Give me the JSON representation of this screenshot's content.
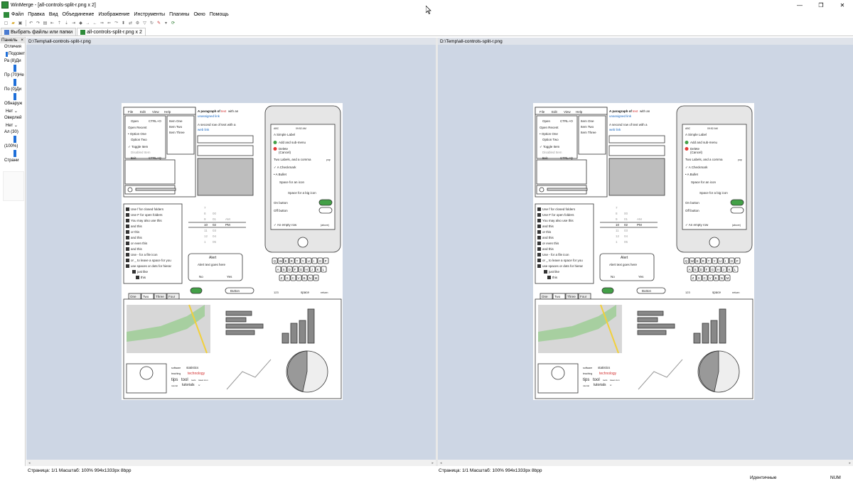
{
  "window": {
    "title": "WinMerge - [all-controls-split-r.png x 2]"
  },
  "menu": [
    "Файл",
    "Правка",
    "Вид",
    "Объединение",
    "Изображение",
    "Инструменты",
    "Плагины",
    "Окно",
    "Помощь"
  ],
  "tabs": [
    {
      "label": "Выбрать файлы или папки"
    },
    {
      "label": "all-controls-split-r.png x 2"
    }
  ],
  "panel": {
    "title": "Панель",
    "close": "×",
    "rows": [
      {
        "label": "Отличия",
        "indent": false,
        "check": false,
        "slider": false
      },
      {
        "label": "Подсвет",
        "indent": true,
        "check": true,
        "slider": false
      },
      {
        "label": "Ра (8)Ди",
        "indent": false,
        "check": false,
        "slider": false
      },
      {
        "label": "",
        "indent": false,
        "check": false,
        "slider": true
      },
      {
        "label": "Пр (70)Не",
        "indent": false,
        "check": false,
        "slider": false
      },
      {
        "label": "",
        "indent": false,
        "check": false,
        "slider": true
      },
      {
        "label": "По (0)Ди",
        "indent": false,
        "check": false,
        "slider": false
      },
      {
        "label": "",
        "indent": false,
        "check": false,
        "slider": true
      },
      {
        "label": "Обнаруж",
        "indent": false,
        "check": false,
        "slider": false
      },
      {
        "label": "Нет ⌄",
        "indent": true,
        "check": false,
        "slider": false
      },
      {
        "label": "Оверлей",
        "indent": false,
        "check": false,
        "slider": false
      },
      {
        "label": "Нет ⌄",
        "indent": true,
        "check": false,
        "slider": false
      },
      {
        "label": "Ал (30)",
        "indent": false,
        "check": false,
        "slider": false
      },
      {
        "label": "",
        "indent": false,
        "check": false,
        "slider": true
      },
      {
        "label": "(100%)",
        "indent": false,
        "check": false,
        "slider": false
      },
      {
        "label": "",
        "indent": false,
        "check": false,
        "slider": true
      },
      {
        "label": "Страни",
        "indent": false,
        "check": false,
        "slider": false
      }
    ]
  },
  "left_pane": {
    "path": "D:\\Temp\\all-controls-split-r.png",
    "status": "Страница: 1/1   Масштаб: 100%   994x1333px   8bpp"
  },
  "right_pane": {
    "path": "D:\\Temp\\all-controls-split-r.png",
    "status": "Страница: 1/1   Масштаб: 100%   994x1333px   8bpp"
  },
  "status": {
    "text": "Идентичные",
    "num": "NUM"
  },
  "mockup": {
    "menu": [
      "File",
      "Edit",
      "View",
      "Help"
    ],
    "menu_items": [
      "Open",
      "CTRL+O",
      "Open Recent",
      "Option One",
      "Option Two",
      "Toggle Item",
      "Disabled Item",
      "Exit",
      "CTRL+Q"
    ],
    "submenu": [
      "Item One",
      "Item Two",
      "Item Three"
    ],
    "para1": [
      "A ",
      "paragraph",
      " of ",
      "text",
      " with an"
    ],
    "para1_link": "unassigned link",
    "para2": [
      "A ",
      "second",
      " ",
      "row",
      " of text with a"
    ],
    "para2_link": "web link",
    "phone_status": [
      "ABC",
      "09:52 AM"
    ],
    "phone_rows": [
      "A Simple Label",
      "Add and sub-menu",
      "Delete",
      "(Cancel)",
      "Two Labels, and a comma",
      "yup",
      "A Checkmark",
      "A Bullet",
      "Space for an icon",
      "Space for a big icon",
      "On button",
      "Off button",
      "An empty row",
      "(above)"
    ],
    "tree": [
      "Use f for closed folders",
      "Use F for open folders",
      "You may also use this",
      "and this",
      "or this",
      "and this",
      "or even this",
      "and this",
      "Use - for a file icon",
      "or _ to leave a space for you",
      "use spaces or dots for hierar",
      "just like",
      "this"
    ],
    "picker": [
      [
        "7",
        "",
        ""
      ],
      [
        "8",
        "00",
        ""
      ],
      [
        "9",
        "01",
        "AM"
      ],
      [
        "10",
        "02",
        "PM"
      ],
      [
        "11",
        "03",
        ""
      ],
      [
        "12",
        "04",
        ""
      ],
      [
        "1",
        "05",
        ""
      ]
    ],
    "alert": {
      "title": "Alert",
      "text": "Alert text goes here",
      "no": "No",
      "yes": "Yes"
    },
    "keyboard": [
      "QWERTYUIOP",
      "ASDFGHJKL",
      "ZXCVBNM"
    ],
    "keys_bottom": [
      "123",
      "space",
      "return"
    ],
    "button_label": "Button",
    "tabs": [
      "One",
      "Two",
      "Three",
      "Four"
    ],
    "cloud": [
      "software",
      "statistics",
      "teaching",
      "technology",
      "tips",
      "tool",
      "tools",
      "tweet",
      "icon",
      "tutorial",
      "tutorials",
      "tv"
    ]
  }
}
